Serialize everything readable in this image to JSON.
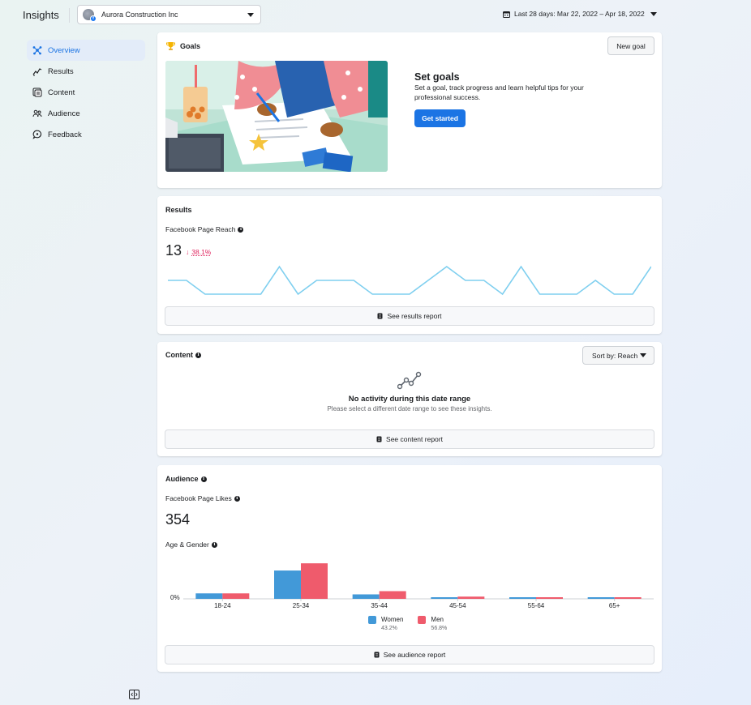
{
  "header": {
    "title": "Insights",
    "page_name": "Aurora Construction Inc",
    "date_range": "Last 28 days: Mar 22, 2022 – Apr 18, 2022"
  },
  "sidebar": {
    "items": [
      {
        "label": "Overview",
        "icon": "overview-icon"
      },
      {
        "label": "Results",
        "icon": "results-icon"
      },
      {
        "label": "Content",
        "icon": "content-icon"
      },
      {
        "label": "Audience",
        "icon": "audience-icon"
      },
      {
        "label": "Feedback",
        "icon": "feedback-icon"
      }
    ]
  },
  "goals": {
    "title": "Goals",
    "new_goal_label": "New goal",
    "heading": "Set goals",
    "description": "Set a goal, track progress and learn helpful tips for your professional success.",
    "cta_label": "Get started"
  },
  "results": {
    "title": "Results",
    "metric_label": "Facebook Page Reach",
    "metric_value": "13",
    "delta_arrow": "↓",
    "delta": "38.1%",
    "report_label": "See results report",
    "sparkline": [
      1,
      1,
      0,
      0,
      0,
      0,
      2,
      0,
      1,
      1,
      1,
      0,
      0,
      0,
      1,
      2,
      1,
      1,
      0,
      2,
      0,
      0,
      0,
      1,
      0,
      0,
      2
    ]
  },
  "content": {
    "title": "Content",
    "sort_label": "Sort by: Reach",
    "empty_title": "No activity during this date range",
    "empty_subtitle": "Please select a different date range to see these insights.",
    "report_label": "See content report"
  },
  "audience": {
    "title": "Audience",
    "metric_label": "Facebook Page Likes",
    "metric_value": "354",
    "age_gender_label": "Age & Gender",
    "zero_label": "0%",
    "report_label": "See audience report"
  },
  "colors": {
    "accent": "#1b74e4",
    "women": "#4299d8",
    "men": "#ef5b6c",
    "sparkline": "#7fcfef",
    "negative": "#e0245e"
  },
  "chart_data": {
    "type": "bar",
    "categories": [
      "18-24",
      "25-34",
      "35-44",
      "45-54",
      "55-64",
      "65+"
    ],
    "series": [
      {
        "name": "Women",
        "share": "43.2%",
        "values": [
          2.2,
          11.4,
          1.8,
          0.6,
          0.6,
          0.6
        ]
      },
      {
        "name": "Men",
        "share": "56.8%",
        "values": [
          2.2,
          14.3,
          3.1,
          0.9,
          0.6,
          0.6
        ]
      }
    ],
    "ylim": [
      0,
      15
    ],
    "legend": "bottom"
  }
}
